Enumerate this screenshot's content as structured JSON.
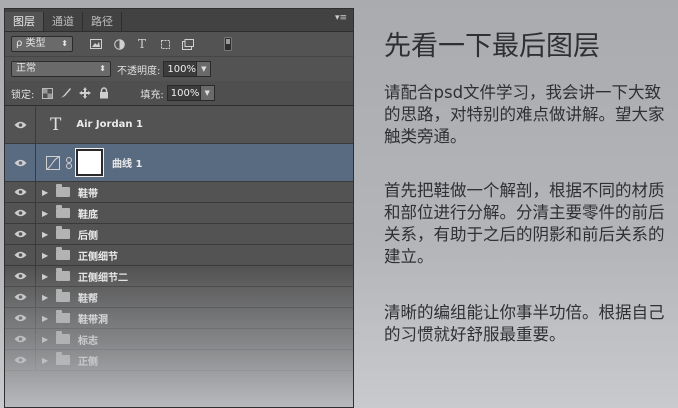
{
  "panel": {
    "tabs": [
      "图层",
      "通道",
      "路径"
    ],
    "menu_glyph": "▾≡",
    "filter": {
      "label": "ρ 类型",
      "arrows": "⬍"
    },
    "filter_icons": [
      "image-filter-icon",
      "adjustment-filter-icon",
      "type-filter-icon",
      "shape-filter-icon",
      "smart-object-filter-icon",
      "filter-toggle-icon"
    ],
    "filter_glyphs": {
      "type": "T"
    },
    "blend_mode": "正常",
    "opacity_label": "不透明度:",
    "opacity_value": "100%",
    "lock_label": "锁定:",
    "fill_label": "填充:",
    "fill_value": "100%",
    "layers": [
      {
        "kind": "text",
        "glyph": "T",
        "name": "Air Jordan 1"
      },
      {
        "kind": "curve",
        "name": "曲线 1"
      },
      {
        "kind": "group",
        "name": "鞋带"
      },
      {
        "kind": "group",
        "name": "鞋底"
      },
      {
        "kind": "group",
        "name": "后侧"
      },
      {
        "kind": "group",
        "name": "正侧细节"
      },
      {
        "kind": "group",
        "name": "正侧细节二"
      },
      {
        "kind": "group",
        "name": "鞋帮"
      },
      {
        "kind": "group",
        "name": "鞋带洞"
      },
      {
        "kind": "group",
        "name": "标志"
      },
      {
        "kind": "group",
        "name": "正侧"
      }
    ]
  },
  "article": {
    "heading": "先看一下最后图层",
    "paragraphs": [
      "请配合psd文件学习，我会讲一下大致的思路，对特别的难点做讲解。望大家触类旁通。",
      "首先把鞋做一个解剖，根据不同的材质和部位进行分解。分清主要零件的前后关系，有助于之后的阴影和前后关系的建立。",
      "清晰的编组能让你事半功倍。根据自己的习惯就好舒服最重要。"
    ]
  },
  "colors": {
    "panel_bg": "#535353",
    "selected_layer": "#596b80",
    "page_bg": "#b0b2b6",
    "text": "#2f3033"
  }
}
